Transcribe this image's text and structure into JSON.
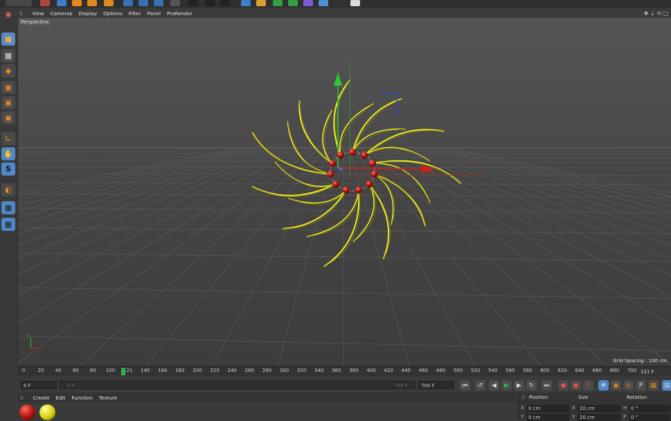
{
  "menubar": {
    "items": [
      "View",
      "Cameras",
      "Display",
      "Options",
      "Filter",
      "Panel",
      "ProRender"
    ]
  },
  "viewport": {
    "label": "Perspective",
    "grid_spacing": "Grid Spacing : 100 cm",
    "axis_y": "Y",
    "axis_x": "X"
  },
  "timeline": {
    "ticks": [
      "0",
      "20",
      "40",
      "60",
      "80",
      "100",
      "121",
      "140",
      "160",
      "180",
      "200",
      "220",
      "240",
      "260",
      "280",
      "300",
      "320",
      "340",
      "360",
      "380",
      "400",
      "420",
      "440",
      "460",
      "480",
      "500",
      "520",
      "540",
      "560",
      "580",
      "600",
      "620",
      "640",
      "660",
      "680",
      "700"
    ],
    "current_frame_label": "121 F",
    "start_field": "0 F",
    "range_start": "0 F",
    "range_end": "700 F",
    "end_field": "700 F"
  },
  "material_manager": {
    "menu": [
      "Create",
      "Edit",
      "Function",
      "Texture"
    ]
  },
  "coordinates": {
    "headers": [
      "Position",
      "Size",
      "Rotation"
    ],
    "row1": {
      "axis1": "X",
      "pos": "0 cm",
      "axis2": "X",
      "size": "20 cm",
      "axis3": "H",
      "rot": "0 °"
    },
    "row2": {
      "axis1": "Y",
      "pos": "0 cm",
      "axis2": "Y",
      "size": "20 cm",
      "axis3": "P",
      "rot": "0 °"
    }
  },
  "colors": {
    "spline": "#f2ee1c",
    "ball": "#c41a12",
    "accent_green": "#2fb35a",
    "y_axis": "#2ec42e",
    "x_axis": "#e01818",
    "z_axis": "#3348c8"
  }
}
